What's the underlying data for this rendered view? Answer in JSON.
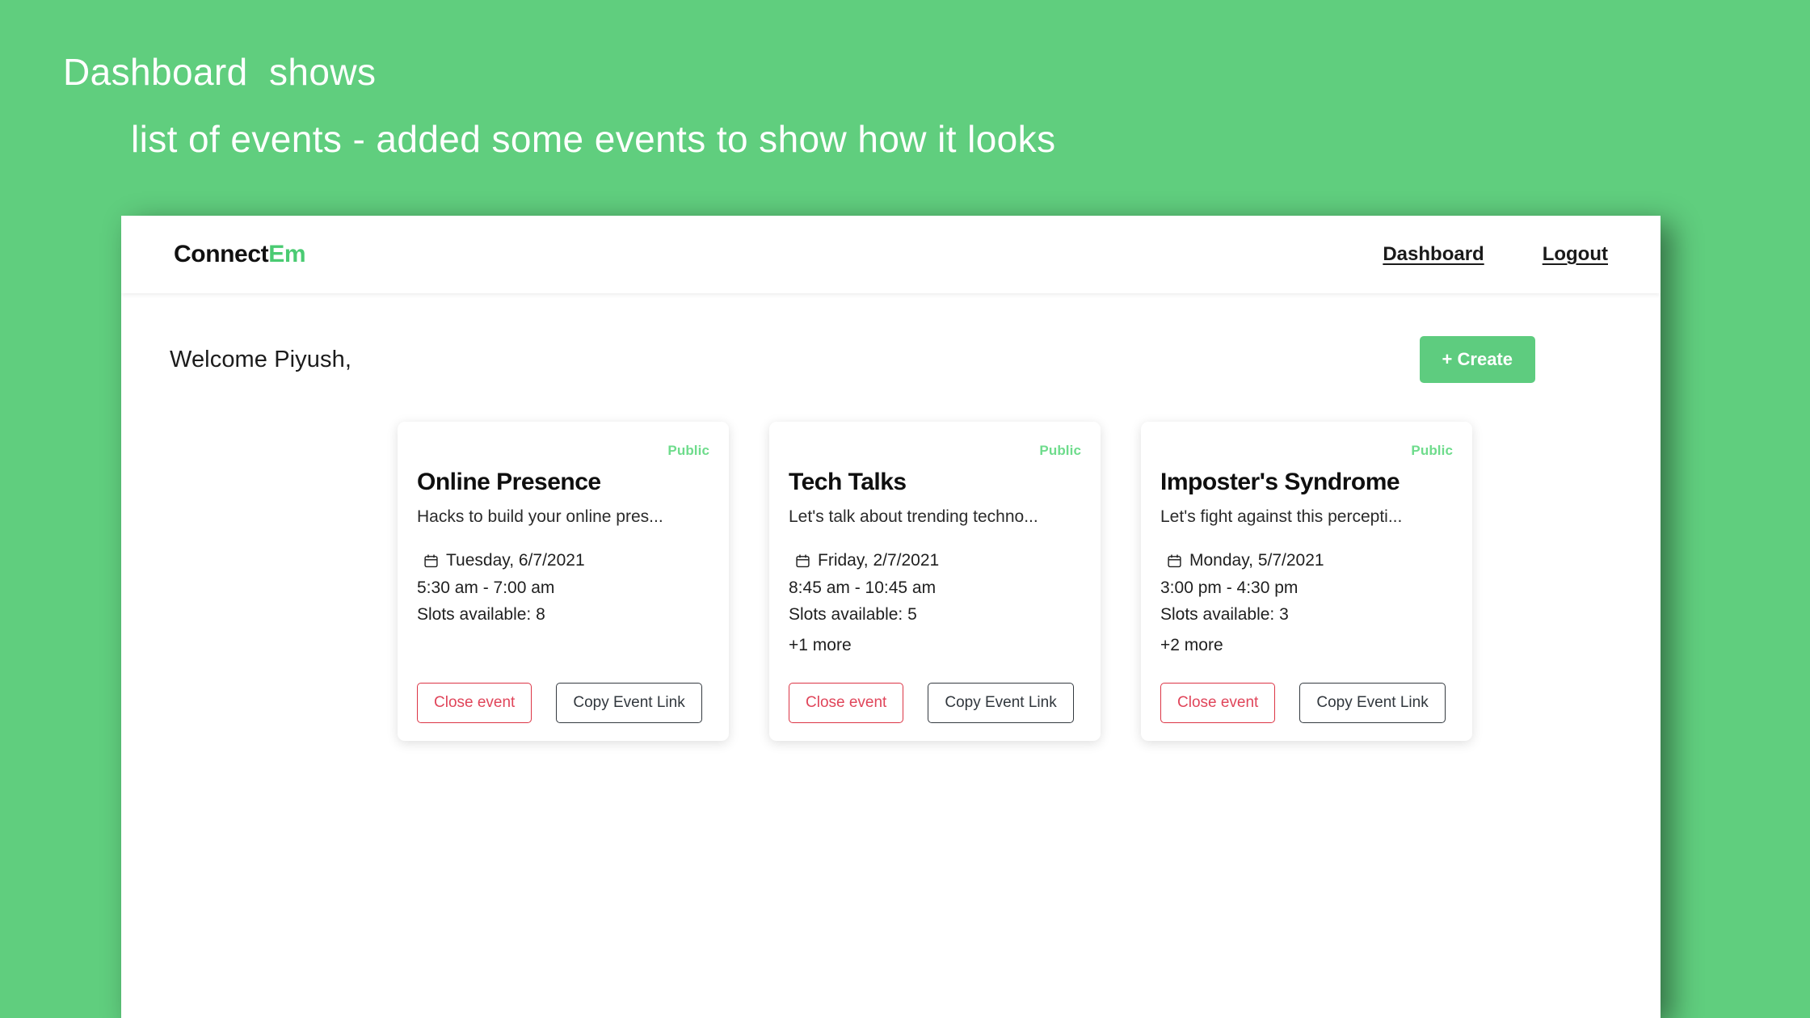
{
  "annotation": {
    "line1": "Dashboard  shows",
    "line2": "list of events - added some events to show how it looks"
  },
  "colors": {
    "background_green": "#60CE7E",
    "brand_accent": "#4ACB72",
    "create_button": "#5ECC7F",
    "badge_green": "#6EDC8C",
    "danger_red": "#DC3545",
    "dark_outline": "#343A40"
  },
  "navbar": {
    "brand_primary": "Connect",
    "brand_accent": "Em",
    "links": [
      {
        "label": "Dashboard"
      },
      {
        "label": "Logout"
      }
    ]
  },
  "main": {
    "welcome": "Welcome Piyush,",
    "create_label": "+ Create",
    "cards": [
      {
        "badge": "Public",
        "title": "Online Presence",
        "description": "Hacks to build your online pres...",
        "date": "Tuesday, 6/7/2021",
        "time": "5:30 am - 7:00 am",
        "slots": "Slots available: 8",
        "more": "",
        "close_label": "Close event",
        "copy_label": "Copy Event Link"
      },
      {
        "badge": "Public",
        "title": "Tech Talks",
        "description": "Let's talk about trending techno...",
        "date": "Friday, 2/7/2021",
        "time": "8:45 am - 10:45 am",
        "slots": "Slots available: 5",
        "more": "+1 more",
        "close_label": "Close event",
        "copy_label": "Copy Event Link"
      },
      {
        "badge": "Public",
        "title": "Imposter's Syndrome",
        "description": "Let's fight against this percepti...",
        "date": "Monday, 5/7/2021",
        "time": "3:00 pm - 4:30 pm",
        "slots": "Slots available: 3",
        "more": "+2 more",
        "close_label": "Close event",
        "copy_label": "Copy Event Link"
      }
    ]
  }
}
